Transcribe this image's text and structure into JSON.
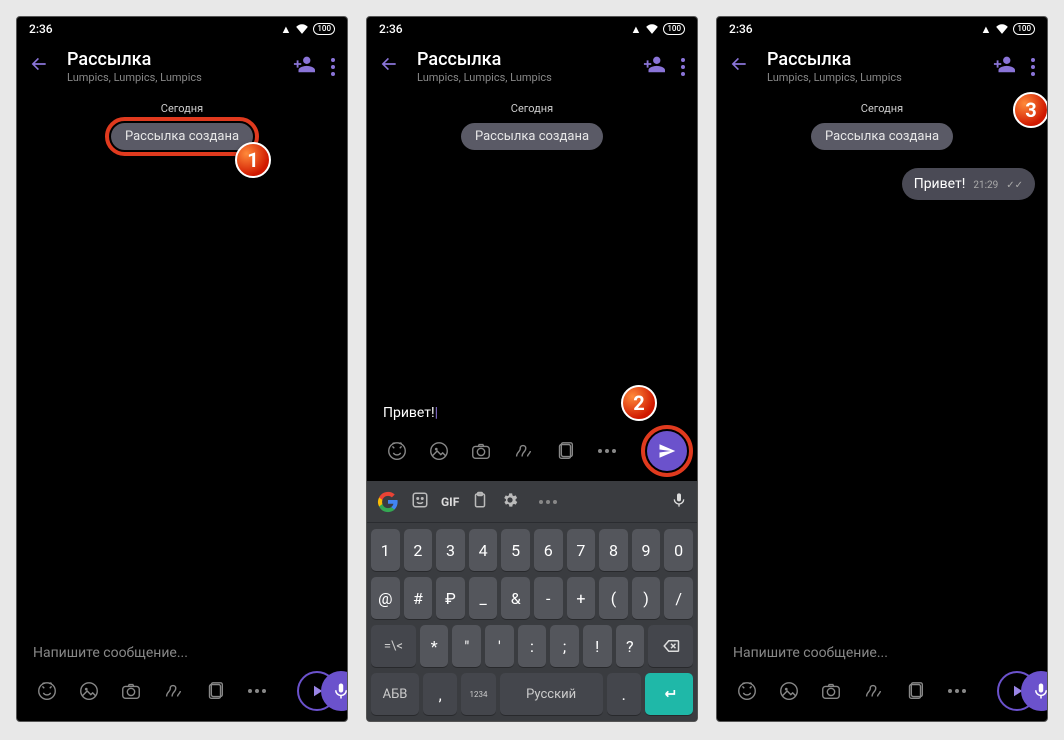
{
  "status": {
    "time": "2:36",
    "battery": "100"
  },
  "header": {
    "title": "Рассылка",
    "subtitle": "Lumpics, Lumpics, Lumpics"
  },
  "chat": {
    "date": "Сегодня",
    "system_pill": "Рассылка создана",
    "outgoing": {
      "text": "Привет!",
      "time": "21:29"
    }
  },
  "compose": {
    "placeholder": "Напишите сообщение...",
    "typed": "Привет!"
  },
  "keyboard": {
    "suggestion_gif": "GIF",
    "row1": [
      "1",
      "2",
      "3",
      "4",
      "5",
      "6",
      "7",
      "8",
      "9",
      "0"
    ],
    "row2": [
      "@",
      "#",
      "₽",
      "_",
      "&",
      "-",
      "+",
      "(",
      ")",
      "/"
    ],
    "row3_lead": "=\\<",
    "row3": [
      "*",
      "\"",
      "'",
      ":",
      ";",
      "!",
      "?"
    ],
    "row4_abc": "АБВ",
    "row4_comma": ",",
    "row4_nums": "1234",
    "row4_lang": "Русский",
    "row4_dot": "."
  },
  "markers": {
    "m1": "1",
    "m2": "2",
    "m3": "3"
  }
}
